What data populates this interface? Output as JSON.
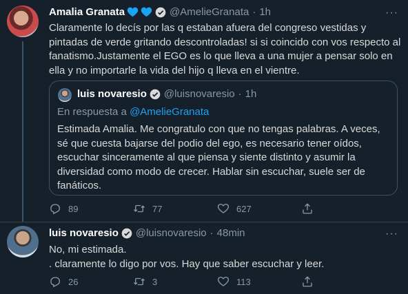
{
  "tweet1": {
    "name": "Amalia Granata",
    "handle": "@AmelieGranata",
    "separator": "·",
    "time": "1h",
    "more": "···",
    "lines": [
      "Claramente lo decís por las q estaban afuera del congreso vestidas y",
      "pintadas de verde gritando descontroladas! si si coincido con vos respecto al",
      "fanatismo.Justamente el EGO es lo que lleva a una mujer a pensar solo en",
      "ella y no importarle la vida del hijo q lleva en el vientre."
    ],
    "quote": {
      "name": "luis novaresio",
      "handle": "@luisnovaresio",
      "separator": "·",
      "time": "1h",
      "reply_prefix": "En respuesta a ",
      "reply_to": "@AmelieGranata",
      "lines": [
        "Estimada Amalia.  Me congratulo con que no tengas palabras.  A veces,",
        "sé que cuesta bajarse del podio del ego, es necesario tener oídos,",
        "escuchar sinceramente al que piensa y siente distinto y asumir la",
        "diversidad como modo de crecer.  Hablar sin escuchar, suele ser de",
        "fanáticos."
      ]
    },
    "actions": {
      "replies": "89",
      "retweets": "77",
      "likes": "627"
    }
  },
  "tweet2": {
    "name": "luis novaresio",
    "handle": "@luisnovaresio",
    "separator": "·",
    "time": "48min",
    "more": "···",
    "lines": [
      "No, mi estimada.",
      ". claramente lo digo por vos.  Hay que saber escuchar y leer."
    ],
    "actions": {
      "replies": "26",
      "retweets": "3",
      "likes": "113"
    }
  },
  "colors": {
    "background": "#15202b",
    "verified": "#1da1f2",
    "hearts": "#1da1f2",
    "muted": "#8899a6"
  }
}
